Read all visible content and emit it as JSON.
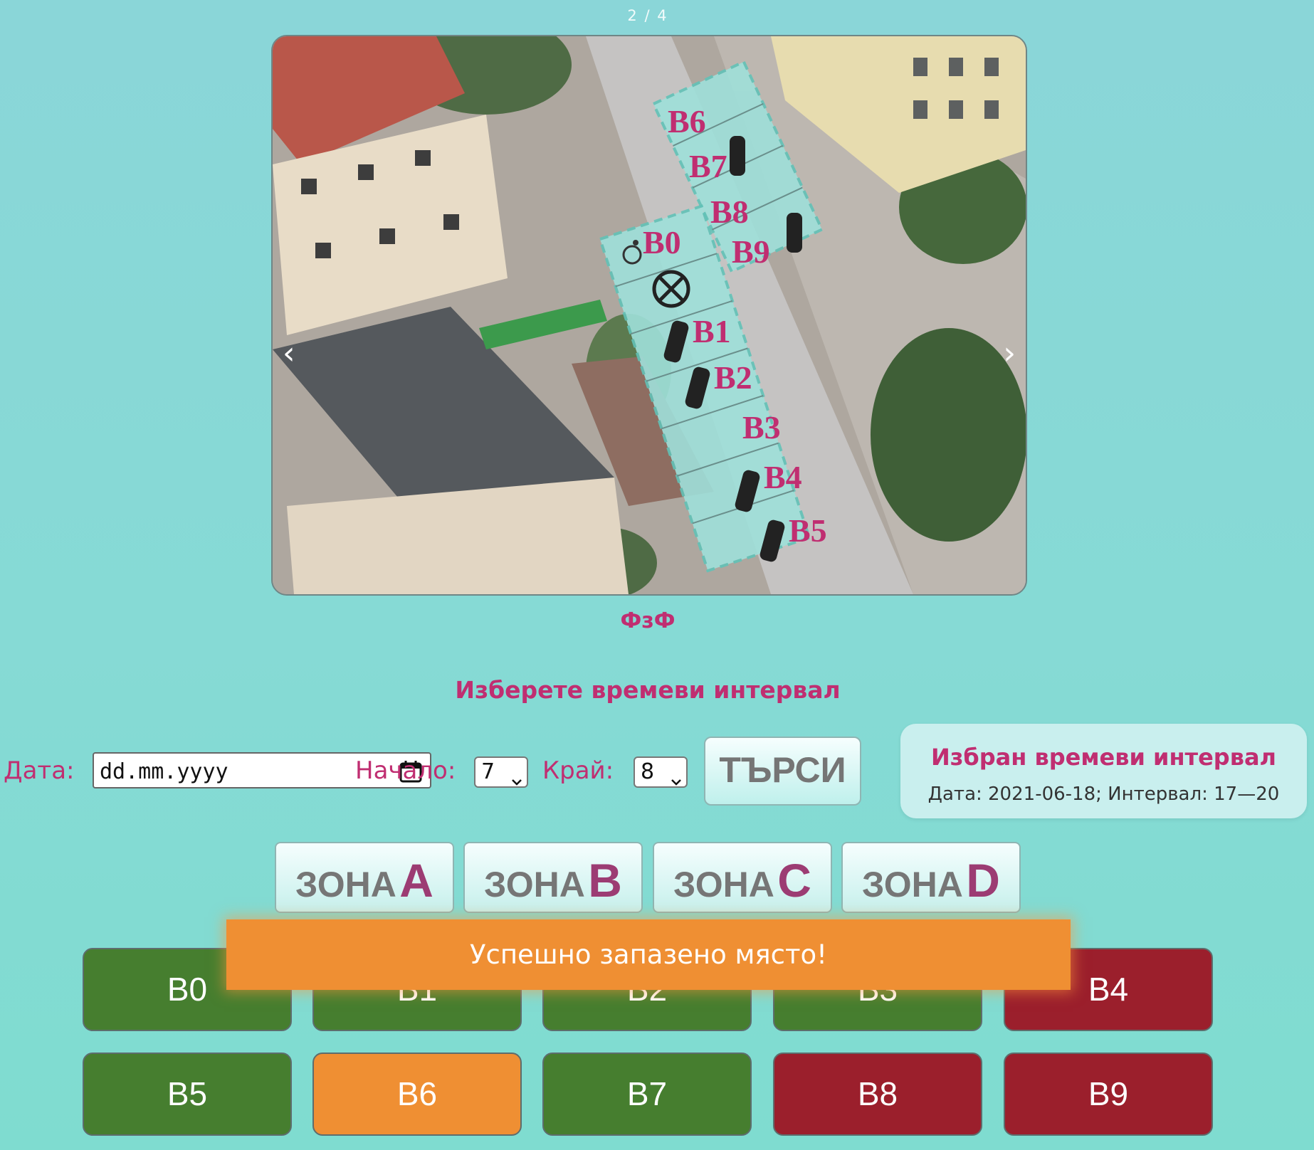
{
  "slider": {
    "counter": "2 / 4",
    "caption": "ФзФ",
    "prev_label": "‹",
    "next_label": "›",
    "map_labels": {
      "top_row": [
        "B6",
        "B7",
        "B8",
        "B9"
      ],
      "bottom_row": [
        "B0",
        "B1",
        "B2",
        "B3",
        "B4",
        "B5"
      ]
    }
  },
  "form": {
    "heading": "Изберете времеви интервал",
    "date_label": "Дата:",
    "date_placeholder": "dd.mm.yyyy",
    "start_label": "Начало:",
    "start_value": "7",
    "end_label": "Край:",
    "end_value": "8",
    "search_label": "ТЪРСИ"
  },
  "selected_interval": {
    "title": "Избран времеви интервал",
    "details": "Дата: 2021-06-18; Интервал: 17—20"
  },
  "zones": [
    {
      "word": "ЗОНА",
      "letter": "A"
    },
    {
      "word": "ЗОНА",
      "letter": "B"
    },
    {
      "word": "ЗОНА",
      "letter": "C"
    },
    {
      "word": "ЗОНА",
      "letter": "D"
    }
  ],
  "spots": [
    {
      "label": "B0",
      "status": "free",
      "color": "#467e2f"
    },
    {
      "label": "B1",
      "status": "free",
      "color": "#467e2f"
    },
    {
      "label": "B2",
      "status": "free",
      "color": "#467e2f"
    },
    {
      "label": "B3",
      "status": "free",
      "color": "#467e2f"
    },
    {
      "label": "B4",
      "status": "taken",
      "color": "#9b1f2c"
    },
    {
      "label": "B5",
      "status": "free",
      "color": "#467e2f"
    },
    {
      "label": "B6",
      "status": "reserved",
      "color": "#ef8f33"
    },
    {
      "label": "B7",
      "status": "free",
      "color": "#467e2f"
    },
    {
      "label": "B8",
      "status": "taken",
      "color": "#9b1f2c"
    },
    {
      "label": "B9",
      "status": "taken",
      "color": "#9b1f2c"
    }
  ],
  "toast": {
    "message": "Успешно запазено място!"
  },
  "colors": {
    "accent_pink": "#c02e71",
    "free": "#467e2f",
    "taken": "#9b1f2c",
    "reserved": "#ef8f33"
  }
}
